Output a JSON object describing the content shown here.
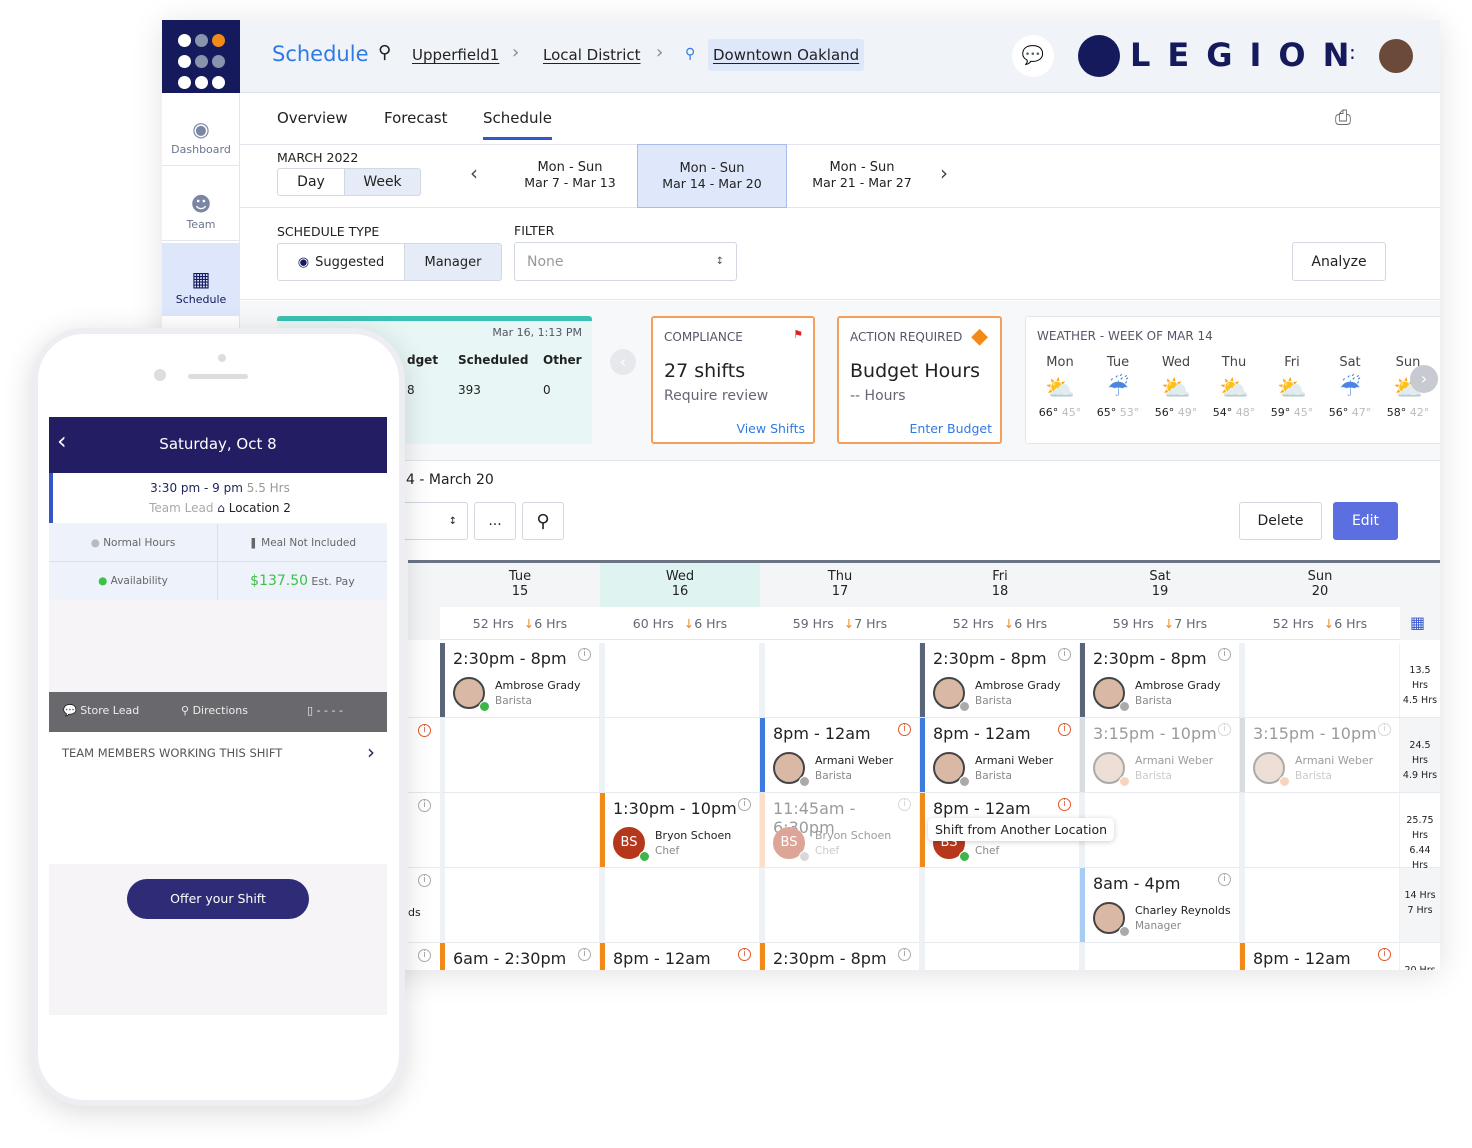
{
  "header": {
    "title": "Schedule",
    "breadcrumb": [
      "Upperfield1",
      "Local District",
      "Downtown Oakland"
    ],
    "brand": "LEGION"
  },
  "sidebar": {
    "items": [
      {
        "label": "Dashboard",
        "icon": "dashboard-icon"
      },
      {
        "label": "Team",
        "icon": "team-icon"
      },
      {
        "label": "Schedule",
        "icon": "calendar-icon",
        "active": true
      }
    ]
  },
  "tabs": [
    {
      "label": "Overview"
    },
    {
      "label": "Forecast"
    },
    {
      "label": "Schedule",
      "active": true
    }
  ],
  "period": {
    "month": "MARCH 2022",
    "views": [
      "Day",
      "Week"
    ],
    "selected_view": "Week",
    "weeks": [
      {
        "days": "Mon - Sun",
        "range": "Mar 7 - Mar 13"
      },
      {
        "days": "Mon - Sun",
        "range": "Mar 14 - Mar 20",
        "selected": true
      },
      {
        "days": "Mon - Sun",
        "range": "Mar 21 - Mar 27"
      }
    ]
  },
  "schedule_type": {
    "label": "SCHEDULE TYPE",
    "options": [
      "Suggested",
      "Manager"
    ],
    "selected": "Manager"
  },
  "filter": {
    "label": "FILTER",
    "value": "None"
  },
  "analyze_label": "Analyze",
  "budget_card": {
    "timestamp": "Mar 16, 1:13 PM",
    "headers": [
      "dget",
      "Scheduled",
      "Other"
    ],
    "values": [
      "8",
      "393",
      "0"
    ]
  },
  "compliance": {
    "title": "COMPLIANCE",
    "value": "27 shifts",
    "sub": "Require review",
    "link": "View Shifts"
  },
  "action": {
    "title": "ACTION REQUIRED",
    "value": "Budget Hours",
    "sub": "-- Hours",
    "link": "Enter Budget"
  },
  "weather": {
    "title": "WEATHER - WEEK OF MAR 14",
    "days": [
      {
        "d": "Mon",
        "hi": "66°",
        "lo": "45°",
        "icon": "partly-sunny"
      },
      {
        "d": "Tue",
        "hi": "65°",
        "lo": "53°",
        "icon": "rain"
      },
      {
        "d": "Wed",
        "hi": "56°",
        "lo": "49°",
        "icon": "partly-sunny"
      },
      {
        "d": "Thu",
        "hi": "54°",
        "lo": "48°",
        "icon": "partly-sunny"
      },
      {
        "d": "Fri",
        "hi": "59°",
        "lo": "45°",
        "icon": "partly-sunny"
      },
      {
        "d": "Sat",
        "hi": "56°",
        "lo": "47°",
        "icon": "rain"
      },
      {
        "d": "Sun",
        "hi": "58°",
        "lo": "42°",
        "icon": "partly-sunny"
      }
    ]
  },
  "week_label": "4 - March 20",
  "toolbar": {
    "more": "...",
    "delete": "Delete",
    "edit": "Edit"
  },
  "grid": {
    "days": [
      {
        "d": "Tue",
        "n": "15",
        "hrs": "52 Hrs",
        "delta": "6 Hrs"
      },
      {
        "d": "Wed",
        "n": "16",
        "hrs": "60 Hrs",
        "delta": "6 Hrs",
        "today": true
      },
      {
        "d": "Thu",
        "n": "17",
        "hrs": "59 Hrs",
        "delta": "7 Hrs"
      },
      {
        "d": "Fri",
        "n": "18",
        "hrs": "52 Hrs",
        "delta": "6 Hrs"
      },
      {
        "d": "Sat",
        "n": "19",
        "hrs": "59 Hrs",
        "delta": "7 Hrs"
      },
      {
        "d": "Sun",
        "n": "20",
        "hrs": "52 Hrs",
        "delta": "6 Hrs"
      }
    ],
    "rows": [
      {
        "left": "",
        "left_text": "",
        "totals": [
          "13.5 Hrs",
          "4.5 Hrs"
        ],
        "cells": [
          {
            "time": "2:30pm - 8pm",
            "name": "Ambrose Grady",
            "role": "Barista",
            "bar": "#5a6478",
            "status": "#3cb54a"
          },
          null,
          null,
          {
            "time": "2:30pm - 8pm",
            "name": "Ambrose Grady",
            "role": "Barista",
            "bar": "#5a6478",
            "status": "#aaaaaa"
          },
          {
            "time": "2:30pm - 8pm",
            "name": "Ambrose Grady",
            "role": "Barista",
            "bar": "#5a6478",
            "status": "#aaaaaa"
          },
          null
        ]
      },
      {
        "left": "warn",
        "left_text": "",
        "totals": [
          "24.5 Hrs",
          "4.9 Hrs"
        ],
        "cells": [
          null,
          null,
          {
            "time": "8pm - 12am",
            "name": "Armani Weber",
            "role": "Barista",
            "bar": "#3d7be0",
            "status": "#aaaaaa",
            "warn": true
          },
          {
            "time": "8pm - 12am",
            "name": "Armani Weber",
            "role": "Barista",
            "bar": "#3d7be0",
            "status": "#aaaaaa",
            "warn": true
          },
          {
            "time": "3:15pm - 10pm",
            "name": "Armani Weber",
            "role": "Barista",
            "bar": "#a9b0bd",
            "status": "#f0a070",
            "faded": true
          },
          {
            "time": "3:15pm - 10pm",
            "name": "Armani Weber",
            "role": "Barista",
            "bar": "#a9b0bd",
            "status": "#f0a070",
            "faded": true
          }
        ]
      },
      {
        "left": "info",
        "left_text": "",
        "totals": [
          "25.75 Hrs",
          "6.44 Hrs"
        ],
        "cells": [
          null,
          {
            "time": "1:30pm - 10pm",
            "name": "Bryon Schoen",
            "role": "Chef",
            "initials": "BS",
            "bar": "#f28a1a",
            "status": "#3cb54a"
          },
          {
            "time": "11:45am - 6:30pm",
            "name": "Bryon Schoen",
            "role": "Chef",
            "initials": "BS",
            "bar": "#f5b98a",
            "status": "#aaaaaa",
            "faded": true
          },
          {
            "time": "8pm - 12am",
            "name": "Bryon Schoen",
            "role": "Chef",
            "initials": "BS",
            "bar": "#f28a1a",
            "status": "#3cb54a",
            "warn": true,
            "tooltip": "Shift from Another Location"
          },
          null,
          null
        ]
      },
      {
        "left": "info",
        "left_text": "ds",
        "totals": [
          "14 Hrs",
          "7 Hrs"
        ],
        "cells": [
          null,
          null,
          null,
          null,
          {
            "time": "8am - 4pm",
            "name": "Charley Reynolds",
            "role": "Manager",
            "bar": "#a8cdf5",
            "status": "#aaaaaa"
          },
          null
        ]
      },
      {
        "left": "info",
        "left_text": "",
        "totals": [
          "20 Hrs",
          ""
        ],
        "cells": [
          {
            "time": "6am - 2:30pm",
            "bar": "#f28a1a"
          },
          {
            "time": "8pm - 12am",
            "bar": "#f28a1a",
            "warn": true
          },
          {
            "time": "2:30pm - 8pm",
            "bar": "#f28a1a"
          },
          null,
          null,
          {
            "time": "8pm - 12am",
            "bar": "#f28a1a",
            "warn": true
          }
        ]
      }
    ]
  },
  "phone": {
    "date": "Saturday, Oct 8",
    "time": "3:30 pm - 9 pm",
    "hours": "5.5 Hrs",
    "role": "Team Lead",
    "location": "Location 2",
    "normal": "Normal Hours",
    "meal": "Meal Not Included",
    "availability": "Availability",
    "pay": "$137.50",
    "pay_label": "Est. Pay",
    "store_lead": "Store Lead",
    "directions": "Directions",
    "phone_val": "- - - -",
    "team": "TEAM MEMBERS WORKING THIS SHIFT",
    "offer": "Offer your Shift"
  },
  "colors": {
    "navy": "#141a5c",
    "accent": "#2f7be6",
    "edit": "#5b6fe0",
    "today": "#dff3f1",
    "orange": "#f28a1a"
  }
}
